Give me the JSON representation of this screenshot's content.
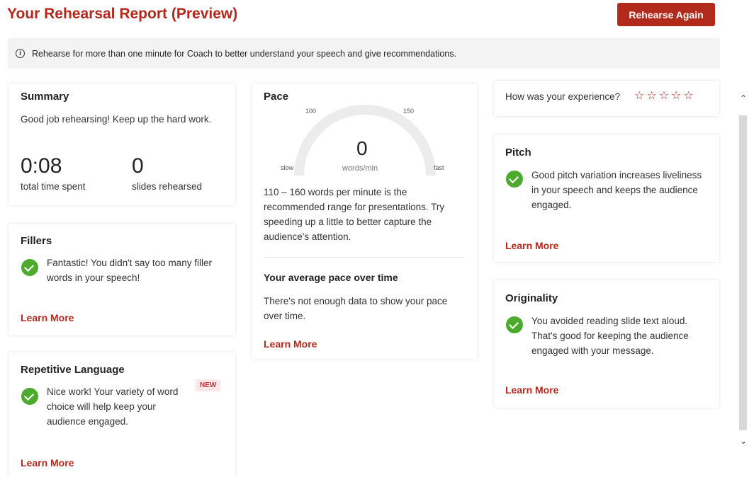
{
  "header": {
    "title": "Your Rehearsal Report (Preview)",
    "rehearse_button": "Rehearse Again"
  },
  "info": {
    "icon": "info-icon",
    "message": "Rehearse for more than one minute for Coach to better understand your speech and give recommendations."
  },
  "summary": {
    "title": "Summary",
    "message": "Good job rehearsing! Keep up the hard work.",
    "time_value": "0:08",
    "time_label": "total time spent",
    "slides_value": "0",
    "slides_label": "slides rehearsed"
  },
  "fillers": {
    "title": "Fillers",
    "message": "Fantastic! You didn't say too many filler words in your speech!",
    "link": "Learn More"
  },
  "repetitive": {
    "title": "Repetitive Language",
    "badge": "NEW",
    "message": "Nice work! Your variety of word choice will help keep your audience engaged.",
    "link": "Learn More"
  },
  "pace": {
    "title": "Pace",
    "gauge_value": "0",
    "gauge_unit": "words/min",
    "tick_100": "100",
    "tick_150": "150",
    "label_slow": "slow",
    "label_fast": "fast",
    "message": "110 – 160 words per minute is the recommended range for presentations. Try speeding up a little to better capture the audience's attention.",
    "over_time_title": "Your average pace over time",
    "over_time_message": "There's not enough data to show your pace over time.",
    "link": "Learn More"
  },
  "experience": {
    "question": "How was your experience?",
    "stars": "☆☆☆☆☆"
  },
  "pitch": {
    "title": "Pitch",
    "message": "Good pitch variation increases liveliness in your speech and keeps the audience engaged.",
    "link": "Learn More"
  },
  "originality": {
    "title": "Originality",
    "message": "You avoided reading slide text aloud. That's good for keeping the audience engaged with your message.",
    "link": "Learn More"
  },
  "scroll": {
    "up": "⌃",
    "down": "⌄"
  }
}
